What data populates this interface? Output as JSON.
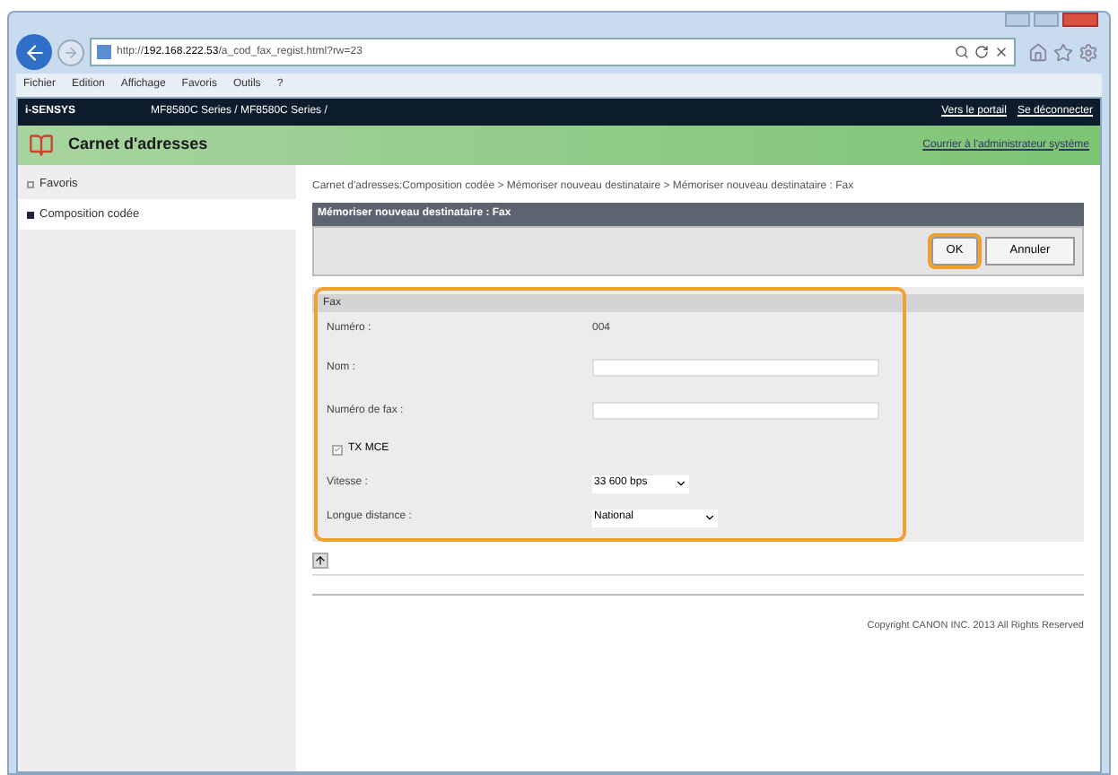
{
  "browser": {
    "url_scheme": "http://",
    "url_host": "192.168.222.53",
    "url_path": "/a_cod_fax_regist.html?rw=23",
    "menu": [
      "Fichier",
      "Edition",
      "Affichage",
      "Favoris",
      "Outils",
      "?"
    ]
  },
  "header": {
    "brand": "i-SENSYS",
    "model": "MF8580C Series / MF8580C Series /",
    "links": [
      "Vers le portail",
      "Se déconnecter"
    ]
  },
  "title_bar": {
    "title": "Carnet d'adresses",
    "link": "Courrier à l'administrateur système"
  },
  "sidebar": {
    "items": [
      {
        "label": "Favoris",
        "selected": false
      },
      {
        "label": "Composition codée",
        "selected": true
      }
    ]
  },
  "breadcrumb": "Carnet d'adresses:Composition codée > Mémoriser nouveau destinataire > Mémoriser nouveau destinataire : Fax",
  "panel": {
    "title": "Mémoriser nouveau destinataire : Fax",
    "buttons": [
      "OK",
      "Annuler"
    ]
  },
  "fax": {
    "title": "Fax",
    "rows": [
      {
        "kind": "text",
        "label": "Numéro :",
        "value": "004"
      },
      {
        "kind": "input",
        "label": "Nom :"
      },
      {
        "kind": "input",
        "label": "Numéro de fax :"
      },
      {
        "kind": "checkbox",
        "label": "TX MCE",
        "checked": true
      },
      {
        "kind": "select",
        "label": "Vitesse :",
        "value": "33 600 bps"
      },
      {
        "kind": "select",
        "label": "Longue distance :",
        "value": "National"
      }
    ]
  },
  "footer": "Copyright CANON INC. 2013 All Rights Reserved"
}
